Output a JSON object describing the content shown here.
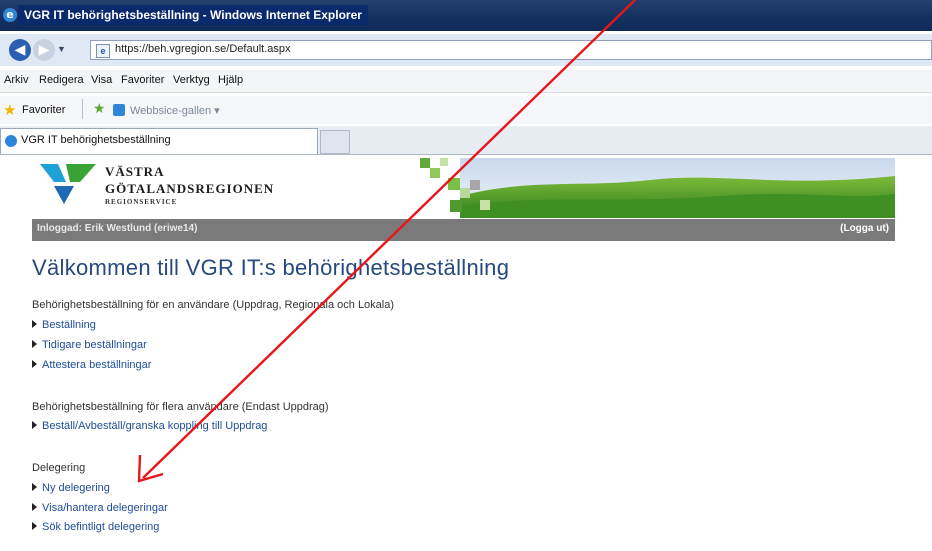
{
  "browser": {
    "window_title": "VGR IT behörighetsbeställning - Windows Internet Explorer",
    "url": "https://beh.vgregion.se/Default.aspx",
    "menu": [
      "Arkiv",
      "Redigera",
      "Visa",
      "Favoriter",
      "Verktyg",
      "Hjälp"
    ],
    "favorites_label": "Favoriter",
    "webslice_label": "Webbsice-gallen ▾",
    "tab_title": "VGR IT behörighetsbeställning"
  },
  "header": {
    "logo_line1": "VÄSTRA",
    "logo_line2": "GÖTALANDSREGIONEN",
    "logo_line3": "REGIONSERVICE",
    "logged_in": "Inloggad: Erik Westlund (eriwe14)",
    "logout": "(Logga ut)"
  },
  "main": {
    "title": "Välkommen till VGR IT:s behörighetsbeställning",
    "sections": [
      {
        "heading": "Behörighetsbeställning för en användare (Uppdrag, Regionala och Lokala)",
        "links": [
          "Beställning",
          "Tidigare beställningar",
          "Attestera beställningar"
        ]
      },
      {
        "heading": "Behörighetsbeställning för flera användare (Endast Uppdrag)",
        "links": [
          "Beställ/Avbeställ/granska koppling till Uppdrag"
        ]
      },
      {
        "heading": "Delegering",
        "links": [
          "Ny delegering",
          "Visa/hantera delegeringar",
          "Sök befintligt delegering"
        ]
      }
    ]
  },
  "annotation": {
    "arrow_color": "#e8161b"
  },
  "colors": {
    "title_blue": "#27497f",
    "link_blue": "#1f4d96",
    "user_bar": "#7a7a7a"
  }
}
